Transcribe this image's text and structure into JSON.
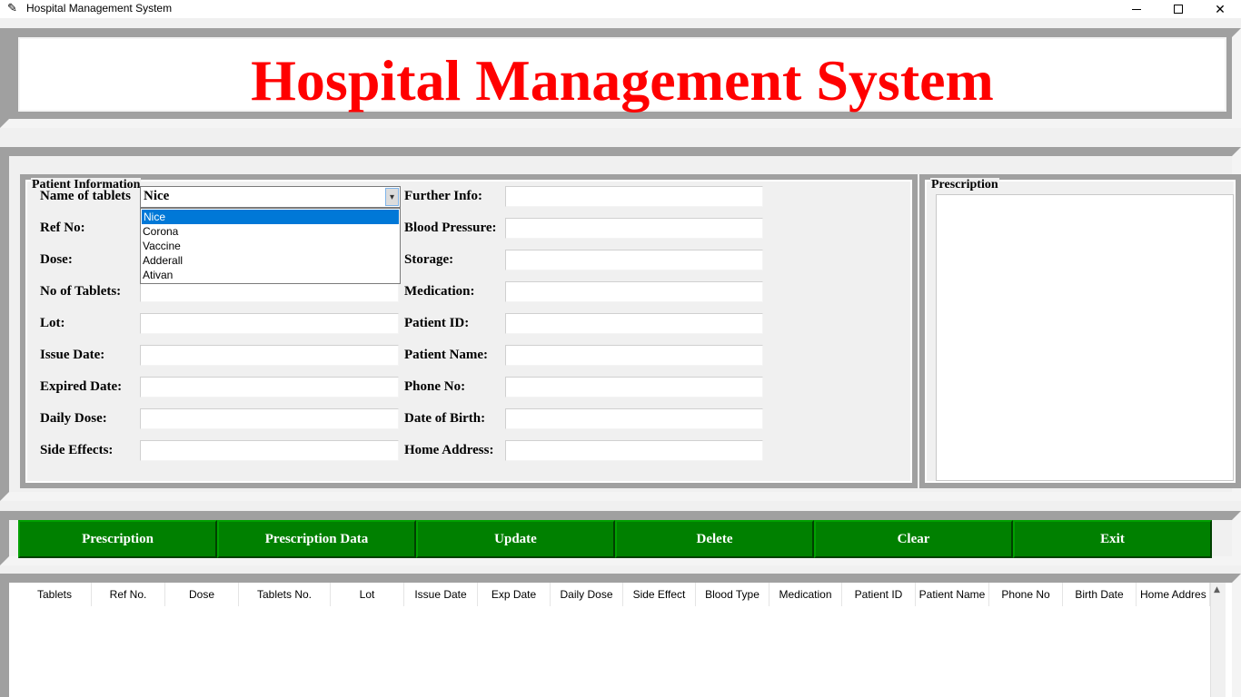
{
  "window": {
    "title": "Hospital Management System",
    "controls": {
      "minimize": "minimize",
      "maximize": "maximize",
      "close": "✕"
    }
  },
  "header": {
    "title": "Hospital Management System"
  },
  "patient_info": {
    "frame_label": "Patient Information",
    "tablet_combo": {
      "label": "Name of tablets",
      "value": "Nice",
      "options": [
        "Nice",
        "Corona",
        "Vaccine",
        "Adderall",
        "Ativan"
      ],
      "selected_index": 0
    },
    "left_labels": [
      "Ref No:",
      "Dose:",
      "No of Tablets:",
      "Lot:",
      "Issue Date:",
      "Expired Date:",
      "Daily Dose:",
      "Side Effects:"
    ],
    "right_labels": [
      "Further Info:",
      "Blood Pressure:",
      "Storage:",
      "Medication:",
      "Patient ID:",
      "Patient Name:",
      "Phone No:",
      "Date of Birth:",
      "Home Address:"
    ]
  },
  "prescription_panel": {
    "frame_label": "Prescription"
  },
  "buttons": [
    "Prescription",
    "Prescription Data",
    "Update",
    "Delete",
    "Clear",
    "Exit"
  ],
  "table": {
    "columns": [
      "Tablets",
      "Ref No.",
      "Dose",
      "Tablets No.",
      "Lot",
      "Issue Date",
      "Exp Date",
      "Daily Dose",
      "Side Effect",
      "Blood Type",
      "Medication",
      "Patient ID",
      "Patient Name",
      "Phone No",
      "Birth Date",
      "Home Addres"
    ]
  },
  "colors": {
    "title_red": "#ff0000",
    "button_green": "#008000",
    "selection_blue": "#0078d7",
    "frame_gray": "#a0a0a0"
  }
}
